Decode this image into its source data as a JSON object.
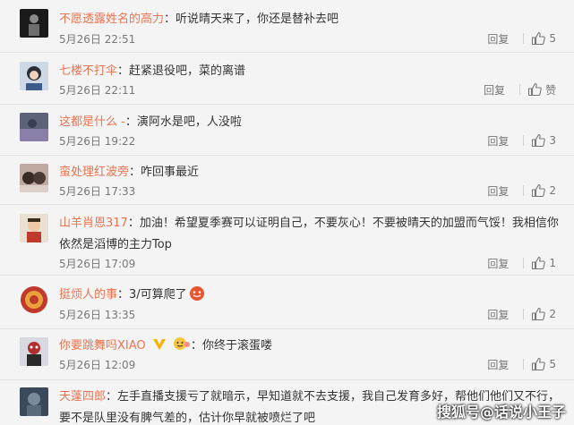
{
  "comments": [
    {
      "user": "不愿透露姓名的高力",
      "text": "听说晴天来了，你还是替补去吧",
      "time": "5月26日 22:51",
      "reply": "回复",
      "likes": "5"
    },
    {
      "user": "七楼不打伞",
      "text": "赶紧退役吧，菜的离谱",
      "time": "5月26日 22:11",
      "reply": "回复",
      "likes": "赞"
    },
    {
      "user": "这都是什么 -",
      "text": "演阿水是吧，人没啦",
      "time": "5月26日 19:22",
      "reply": "回复",
      "likes": "3"
    },
    {
      "user": "蛮处理红波旁",
      "text": "咋回事最近",
      "time": "5月26日 17:33",
      "reply": "回复",
      "likes": "2"
    },
    {
      "user": "山羊肖恩317",
      "text": "加油！希望夏季赛可以证明自己，不要灰心！不要被晴天的加盟而气馁！我相信你",
      "text2": "依然是滔博的主力Top",
      "time": "5月26日 17:09",
      "reply": "回复",
      "likes": "1"
    },
    {
      "user": "挺烦人的事",
      "text": "3/可算爬了",
      "time": "5月26日 13:35",
      "reply": "回复",
      "likes": "2"
    },
    {
      "user": "你要跳舞吗XIAO",
      "text": "你终于滚蛋喽",
      "time": "5月26日 12:09",
      "reply": "回复",
      "likes": "5"
    },
    {
      "user": "天蓬四郎",
      "text": "左手直播支援亏了就暗示，早知道就不去支援，我自己发育多好，帮他们他们又不行，",
      "text2": "要不是队里没有脾气差的，估计你早就被喷烂了吧"
    }
  ],
  "watermark": "搜狐号@话说小王子",
  "colors": {
    "username": "#eb7350",
    "text": "#333333",
    "meta": "#777777",
    "bg": "#f4f4f4"
  },
  "icons": {
    "like": "thumbs-up-icon",
    "vip": "v-badge-icon",
    "emoji": "emoji-icon"
  }
}
